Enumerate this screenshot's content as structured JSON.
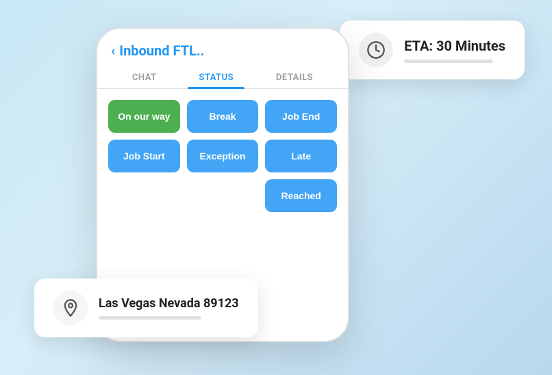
{
  "app": {
    "title": "Inbound FTL..",
    "back_label": "‹"
  },
  "tabs": [
    {
      "id": "chat",
      "label": "CHAT",
      "active": false
    },
    {
      "id": "status",
      "label": "STATUS",
      "active": true
    },
    {
      "id": "details",
      "label": "DETAILS",
      "active": false
    }
  ],
  "status_buttons": [
    {
      "id": "on-our-way",
      "label": "On our way",
      "active": true,
      "col": 1,
      "row": 1
    },
    {
      "id": "break",
      "label": "Break",
      "active": false,
      "col": 2,
      "row": 1
    },
    {
      "id": "job-end",
      "label": "Job End",
      "active": false,
      "col": 3,
      "row": 1
    },
    {
      "id": "job-start",
      "label": "Job Start",
      "active": false,
      "col": 1,
      "row": 2
    },
    {
      "id": "exception",
      "label": "Exception",
      "active": false,
      "col": 2,
      "row": 2
    },
    {
      "id": "late",
      "label": "Late",
      "active": false,
      "col": 3,
      "row": 2
    },
    {
      "id": "reached",
      "label": "Reached",
      "active": false,
      "col": 3,
      "row": 3
    }
  ],
  "eta_card": {
    "label": "ETA: 30 Minutes"
  },
  "location_card": {
    "label": "Las Vegas Nevada 89123"
  }
}
